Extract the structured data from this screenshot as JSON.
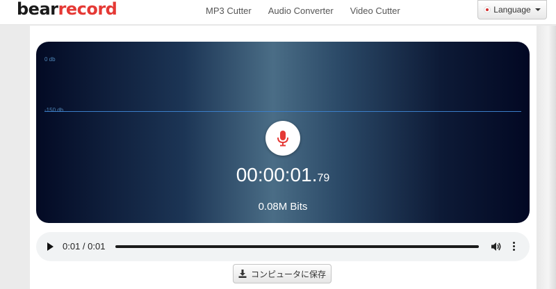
{
  "brand": {
    "part1": "bear",
    "part2": "record"
  },
  "nav": {
    "links": [
      {
        "label": "MP3 Cutter"
      },
      {
        "label": "Audio Converter"
      },
      {
        "label": "Video Cutter"
      }
    ],
    "language_label": "Language"
  },
  "recorder": {
    "db_max_label": "0 db",
    "db_min_label": "-150 db",
    "timer_main": "00:00:01.",
    "timer_centis": "79",
    "bits_label": "0.08M Bits",
    "mic_color": "#e53935"
  },
  "player": {
    "time_display": "0:01 / 0:01",
    "progress_fraction": 1.0
  },
  "save_button_label": "コンピュータに保存",
  "colors": {
    "accent_red": "#e53935",
    "waveform_line": "#3b7ec9"
  }
}
